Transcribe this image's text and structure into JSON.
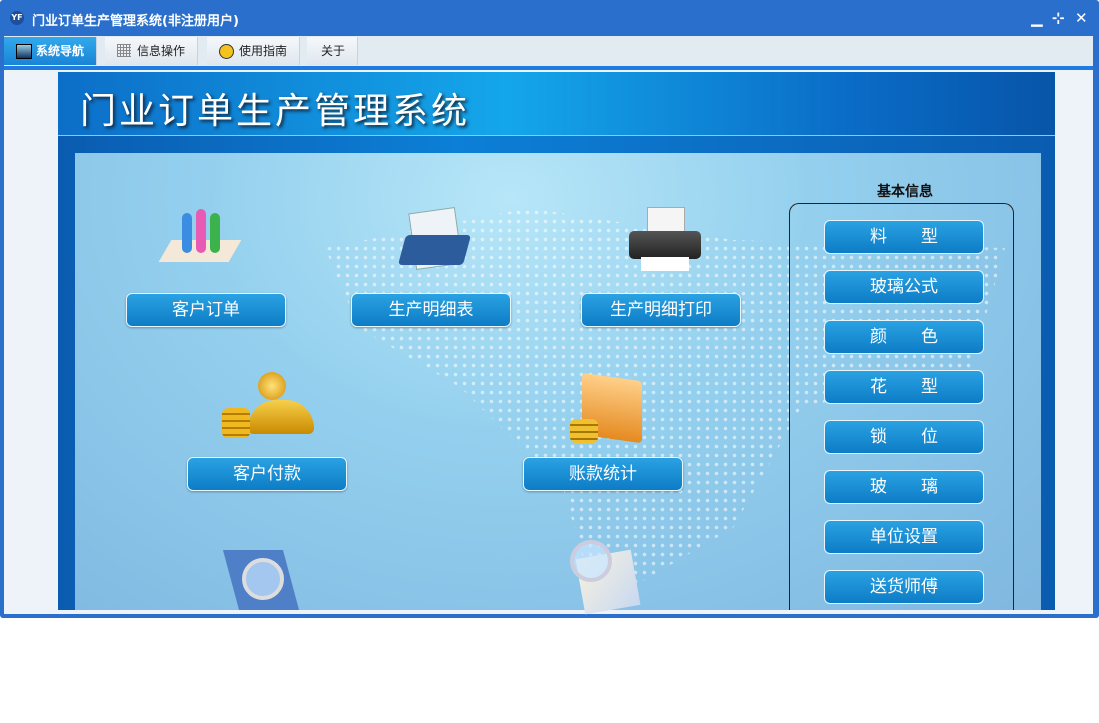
{
  "window": {
    "title": "门业订单生产管理系统(非注册用户)",
    "logo": "YF"
  },
  "menu": [
    {
      "label": "系统导航",
      "icon": "monitor-icon"
    },
    {
      "label": "信息操作",
      "icon": "grid-icon"
    },
    {
      "label": "使用指南",
      "icon": "help-icon"
    },
    {
      "label": "关于"
    }
  ],
  "banner": {
    "title": "门业订单生产管理系统"
  },
  "main_buttons": {
    "orders": "客户订单",
    "detail": "生产明细表",
    "print": "生产明细打印",
    "payment": "客户付款",
    "accounts": "账款统计"
  },
  "side": {
    "title": "基本信息",
    "items": [
      "料　　型",
      "玻璃公式",
      "颜　　色",
      "花　　型",
      "锁　　位",
      "玻　　璃",
      "单位设置",
      "送货师傅"
    ]
  }
}
